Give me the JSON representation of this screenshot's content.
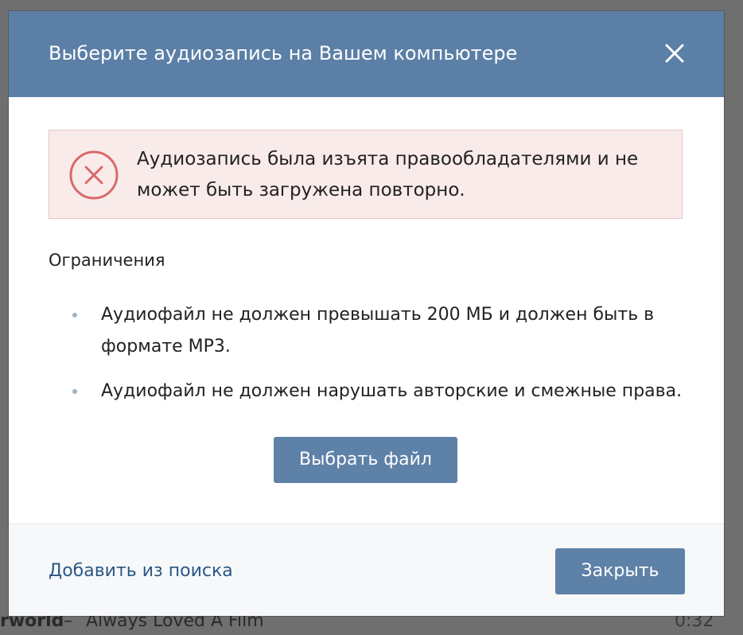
{
  "background": {
    "now_playing": {
      "artist": "rworld",
      "separator": "–",
      "title": "Always Loved A Film",
      "duration": "0:32"
    }
  },
  "modal": {
    "title": "Выберите аудиозапись на Вашем компьютере",
    "close_icon": "close-icon",
    "error": {
      "icon": "error-circle-x-icon",
      "message": "Аудиозапись была изъята правообладателями и не может быть загружена повторно."
    },
    "restrictions": {
      "title": "Ограничения",
      "items": [
        "Аудиофайл не должен превышать 200 МБ и должен быть в формате MP3.",
        "Аудиофайл не должен нарушать авторские и смежные права."
      ]
    },
    "select_button_label": "Выбрать файл",
    "footer": {
      "add_from_search_label": "Добавить из поиска",
      "close_button_label": "Закрыть"
    }
  },
  "colors": {
    "header": "#5b7fa6",
    "button": "#5e81a8",
    "error_bg": "#faebeb",
    "error_border": "#e6c3c3",
    "error_icon": "#d96a6a",
    "link": "#2a5885"
  }
}
